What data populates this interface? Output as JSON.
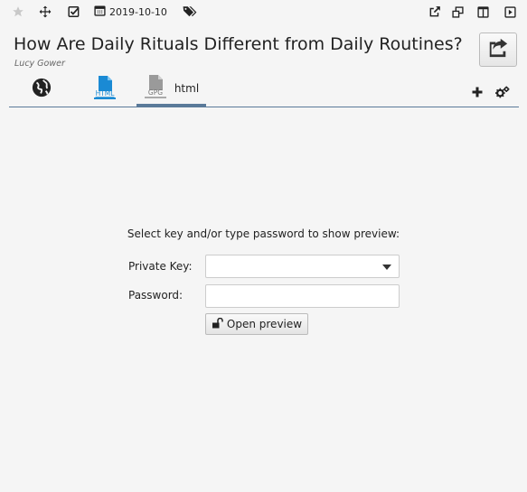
{
  "toolbar": {
    "date": "2019-10-10",
    "icons": [
      "star-icon",
      "move-icon",
      "checkbox-icon",
      "calendar-icon",
      "tags-icon",
      "external-link-icon",
      "restore-window-icon",
      "split-view-icon",
      "play-icon"
    ]
  },
  "article": {
    "title": "How Are Daily Rituals Different from Daily Routines?",
    "author": "Lucy Gower"
  },
  "tabs": [
    {
      "icon": "globe-icon",
      "label": ""
    },
    {
      "icon": "html-file-icon",
      "label": "",
      "icon_text": "HTML"
    },
    {
      "icon": "gpg-file-icon",
      "label": "html",
      "icon_text": "GPG",
      "active": true
    }
  ],
  "preview": {
    "prompt": "Select key and/or type password to show preview:",
    "private_key_label": "Private Key:",
    "private_key_value": "",
    "password_label": "Password:",
    "password_value": "",
    "open_button_label": "Open preview"
  },
  "colors": {
    "accent": "#5a7a99",
    "html_icon_blue": "#1a8ad4",
    "gpg_icon_gray": "#9a9a9a",
    "background": "#f5f5f5"
  }
}
